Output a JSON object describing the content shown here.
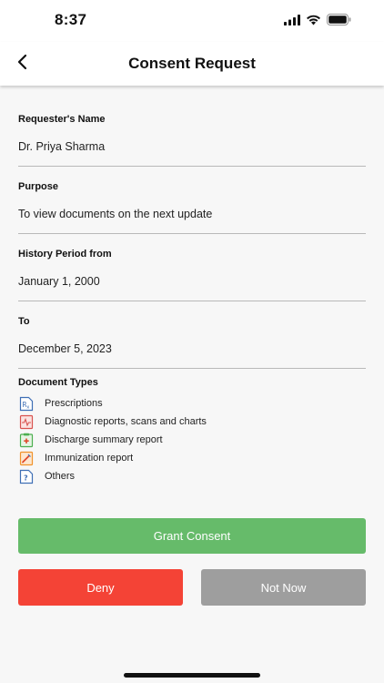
{
  "status_bar": {
    "time": "8:37",
    "icons": [
      "signal-icon",
      "wifi-icon",
      "battery-icon"
    ]
  },
  "nav": {
    "back_icon": "chevron-left-icon",
    "title": "Consent Request"
  },
  "fields": [
    {
      "label": "Requester's Name",
      "value": "Dr. Priya Sharma"
    },
    {
      "label": "Purpose",
      "value": "To view documents on the next update"
    },
    {
      "label": "History Period from",
      "value": "January 1, 2000"
    },
    {
      "label": "To",
      "value": "December 5, 2023"
    }
  ],
  "document_types": {
    "title": "Document Types",
    "items": [
      {
        "label": "Prescriptions",
        "icon": "prescription-icon"
      },
      {
        "label": "Diagnostic reports, scans and charts",
        "icon": "diagnostic-report-icon"
      },
      {
        "label": "Discharge summary report",
        "icon": "discharge-summary-icon"
      },
      {
        "label": "Immunization report",
        "icon": "immunization-icon"
      },
      {
        "label": "Others",
        "icon": "others-icon"
      }
    ]
  },
  "buttons": {
    "grant": "Grant Consent",
    "deny": "Deny",
    "not_now": "Not Now"
  },
  "colors": {
    "grant": "#66bb6a",
    "deny": "#f44336",
    "not_now": "#9e9e9e",
    "background": "#f7f7f7"
  }
}
